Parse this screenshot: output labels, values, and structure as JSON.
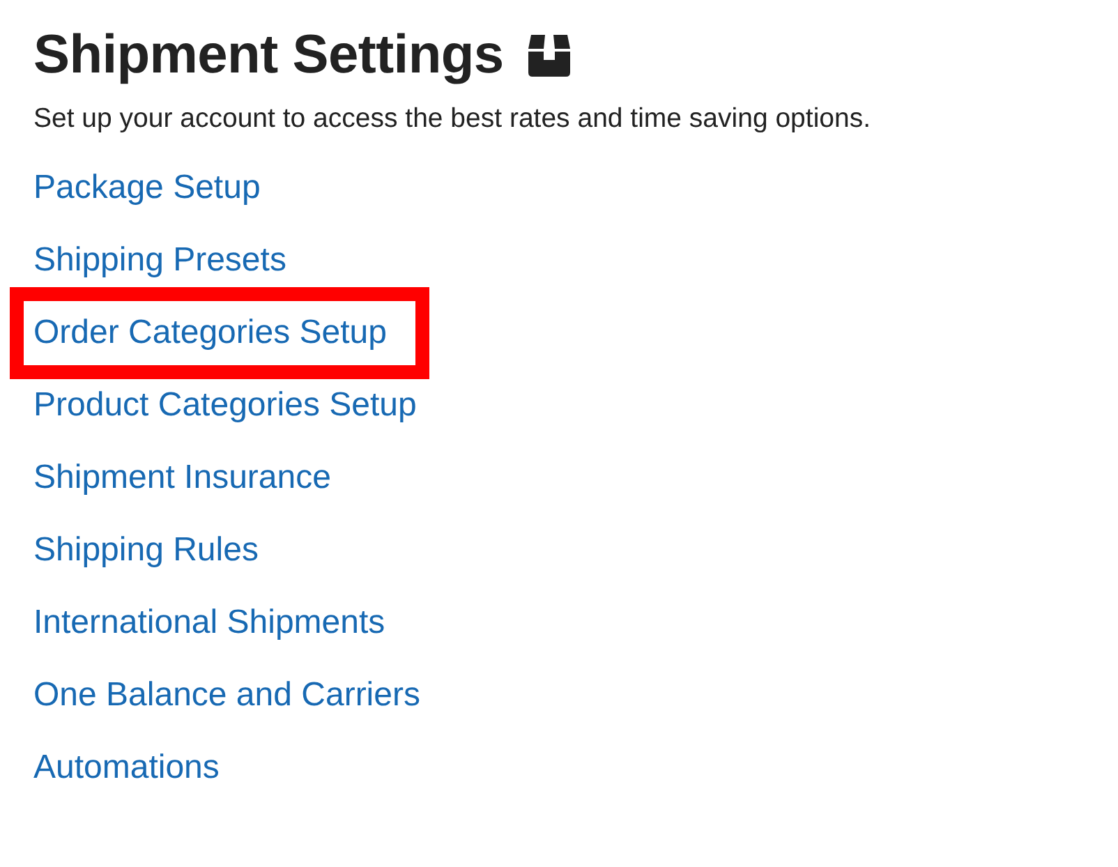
{
  "title": "Shipment Settings",
  "subtitle": "Set up your account to access the best rates and time saving options.",
  "links": [
    {
      "label": "Package Setup",
      "highlighted": false
    },
    {
      "label": "Shipping Presets",
      "highlighted": false
    },
    {
      "label": "Order Categories Setup",
      "highlighted": true
    },
    {
      "label": "Product Categories Setup",
      "highlighted": false
    },
    {
      "label": "Shipment Insurance",
      "highlighted": false
    },
    {
      "label": "Shipping Rules",
      "highlighted": false
    },
    {
      "label": "International Shipments",
      "highlighted": false
    },
    {
      "label": "One Balance and Carriers",
      "highlighted": false
    },
    {
      "label": "Automations",
      "highlighted": false
    }
  ]
}
